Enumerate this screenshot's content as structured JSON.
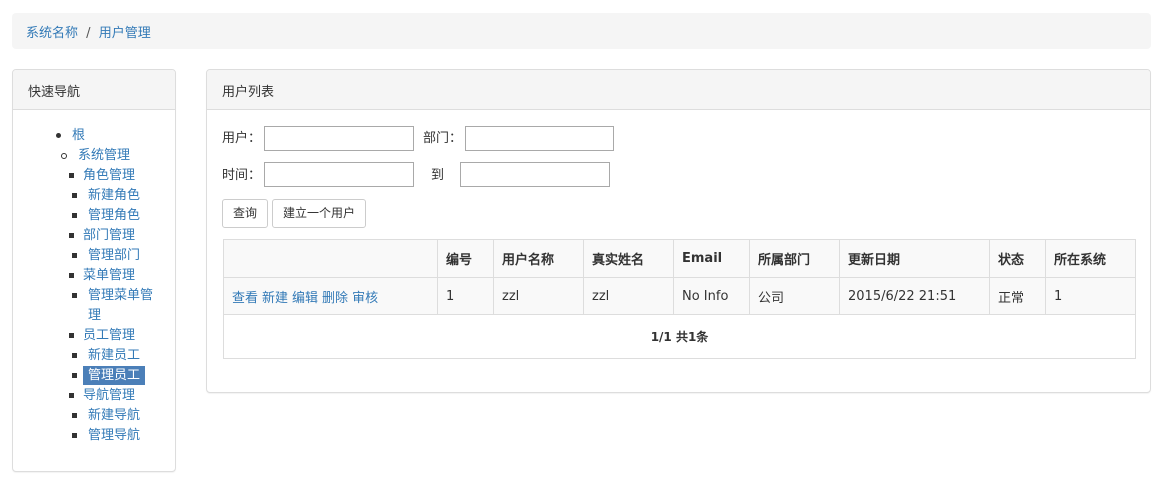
{
  "breadcrumb": {
    "system_name": "系统名称",
    "separator": "/",
    "current": "用户管理"
  },
  "sidebar": {
    "title": "快速导航",
    "items": [
      {
        "label": "根",
        "bullet": "disc",
        "active": false
      },
      {
        "label": "系统管理",
        "bullet": "circle",
        "active": false
      },
      {
        "label": "角色管理",
        "bullet": "square",
        "active": false
      },
      {
        "label": "新建角色",
        "bullet": "square",
        "active": false
      },
      {
        "label": "管理角色",
        "bullet": "square",
        "active": false
      },
      {
        "label": "部门管理",
        "bullet": "square",
        "active": false
      },
      {
        "label": "管理部门",
        "bullet": "square",
        "active": false
      },
      {
        "label": "菜单管理",
        "bullet": "square",
        "active": false
      },
      {
        "label": "管理菜单管",
        "label_line2": "理",
        "bullet": "square",
        "active": false
      },
      {
        "label": "员工管理",
        "bullet": "square",
        "active": false
      },
      {
        "label": "新建员工",
        "bullet": "square",
        "active": false
      },
      {
        "label": "管理员工",
        "bullet": "square",
        "active": true
      },
      {
        "label": "导航管理",
        "bullet": "square",
        "active": false
      },
      {
        "label": "新建导航",
        "bullet": "square",
        "active": false
      },
      {
        "label": "管理导航",
        "bullet": "square",
        "active": false
      }
    ]
  },
  "main": {
    "title": "用户列表",
    "filters": {
      "user_label": "用户：",
      "user_value": "",
      "dept_label": "部门：",
      "dept_value": "",
      "time_label": "时间：",
      "time_from_value": "",
      "to_label": "到",
      "time_to_value": ""
    },
    "buttons": {
      "query": "查询",
      "create_user": "建立一个用户"
    },
    "table": {
      "columns": [
        "",
        "编号",
        "用户名称",
        "真实姓名",
        "Email",
        "所属部门",
        "更新日期",
        "状态",
        "所在系统"
      ],
      "rows": [
        {
          "actions": [
            "查看",
            "新建",
            "编辑",
            "删除",
            "审核"
          ],
          "id": "1",
          "username": "zzl",
          "realname": "zzl",
          "email": "No Info",
          "department": "公司",
          "updated": "2015/6/22 21:51",
          "status": "正常",
          "system": "1"
        }
      ],
      "pager": "1/1 共1条"
    }
  },
  "colors": {
    "link": "#337ab7",
    "active_nav_bg": "#4b7fb8",
    "panel_heading_bg": "#f5f5f5",
    "border": "#dddddd"
  }
}
